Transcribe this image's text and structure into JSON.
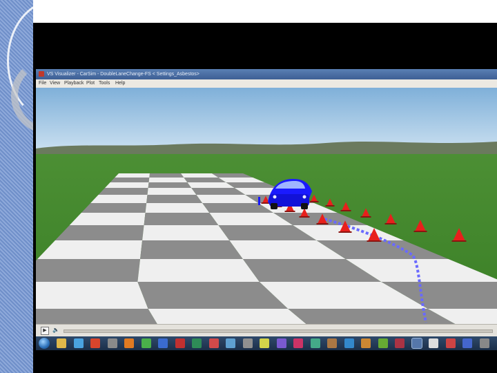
{
  "window": {
    "title": "VS Visualizer - CarSim - DoubleLaneChange-FS < Settings_Asbestos>",
    "menus": [
      "File",
      "View",
      "Playback",
      "Plot",
      "Tools",
      "Help"
    ]
  },
  "scene": {
    "vehicle_color": "#1a1aff",
    "cone_color": "#e8201c",
    "path_color": "#6a6aff",
    "sky_color": "#9ec7e4",
    "grass_color": "#3e8a2a"
  },
  "controls": {
    "play_icon": "play-icon",
    "speaker_icon": "speaker-icon"
  },
  "taskbar": {
    "icons": [
      "start-orb-icon",
      "folder-icon",
      "media-icon",
      "filezilla-icon",
      "window-icon",
      "firefox-icon",
      "chrome-icon",
      "matlab-icon",
      "excel-icon",
      "powerpoint-icon",
      "carsim-icon",
      "app-icon",
      "app-icon",
      "app-icon",
      "app-icon",
      "app-icon",
      "app-icon",
      "app-icon",
      "app-icon",
      "app-icon",
      "app-icon",
      "app-icon",
      "carsim-active-icon",
      "app-icon",
      "app-icon",
      "app-icon",
      "app-icon"
    ]
  }
}
